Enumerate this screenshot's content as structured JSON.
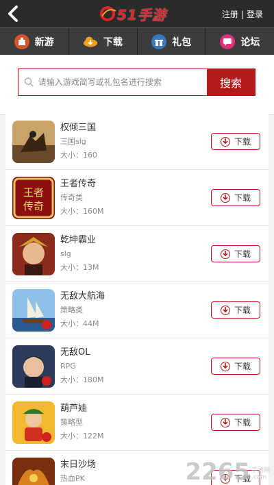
{
  "header": {
    "logo_text": "51手游",
    "register": "注册",
    "separator": "|",
    "login": "登录"
  },
  "nav": [
    {
      "label": "新游",
      "icon": "new-game-icon",
      "color": "#d9532b"
    },
    {
      "label": "下载",
      "icon": "cloud-download-icon",
      "color": "#f0a020"
    },
    {
      "label": "礼包",
      "icon": "gift-icon",
      "color": "#3a79c0"
    },
    {
      "label": "论坛",
      "icon": "forum-icon",
      "color": "#e0307a"
    }
  ],
  "search": {
    "placeholder": "请输入游戏简写或礼包名进行搜索",
    "button": "搜索"
  },
  "colors": {
    "accent": "#b31b1b",
    "topbar": "#2b2b2b",
    "navbar": "#3c3c3c"
  },
  "games": [
    {
      "name": "权倾三国",
      "category": "三国slg",
      "size": "大小：160",
      "download": "下载",
      "thumb": "#6b4a2a"
    },
    {
      "name": "王者传奇",
      "category": "传奇类",
      "size": "大小：160M",
      "download": "下载",
      "thumb": "#8a1010"
    },
    {
      "name": "乾坤霸业",
      "category": "slg",
      "size": "大小：13M",
      "download": "下载",
      "thumb": "#8b2b1b"
    },
    {
      "name": "无敌大航海",
      "category": "策略类",
      "size": "大小：44M",
      "download": "下载",
      "thumb": "#4a7fb0"
    },
    {
      "name": "无敌OL",
      "category": "RPG",
      "size": "大小：180M",
      "download": "下载",
      "thumb": "#2c3c5a"
    },
    {
      "name": "葫芦娃",
      "category": "策略型",
      "size": "大小：122M",
      "download": "下载",
      "thumb": "#e09020"
    },
    {
      "name": "末日沙场",
      "category": "热血PK",
      "size": "",
      "download": "下载",
      "thumb": "#7a3010"
    }
  ],
  "watermark": {
    "number": "2265",
    "suffix_top": "手游网",
    "suffix_bottom": ".com"
  }
}
